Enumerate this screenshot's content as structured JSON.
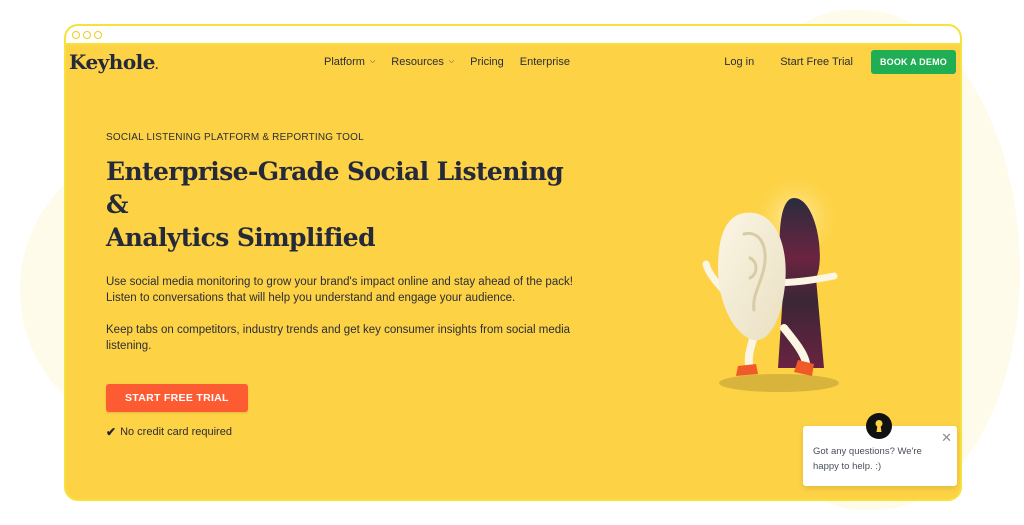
{
  "colors": {
    "page_yellow": "#fdd245",
    "frame_border": "#f7e13c",
    "dark_text": "#252a3b",
    "cta_orange": "#fd5b32",
    "demo_green": "#1fae53"
  },
  "header": {
    "logo": "Keyhole",
    "nav": [
      {
        "label": "Platform",
        "has_dropdown": true
      },
      {
        "label": "Resources",
        "has_dropdown": true
      },
      {
        "label": "Pricing",
        "has_dropdown": false
      },
      {
        "label": "Enterprise",
        "has_dropdown": false
      }
    ],
    "login": "Log in",
    "start_trial": "Start Free Trial",
    "book_demo": "BOOK A DEMO"
  },
  "hero": {
    "eyebrow": "SOCIAL LISTENING PLATFORM & REPORTING TOOL",
    "headline_line1": "Enterprise-Grade Social Listening &",
    "headline_line2": "Analytics Simplified",
    "paragraph1": "Use social media monitoring to grow your brand's impact online and stay ahead of the pack! Listen to conversations that will help you understand and engage your audience.",
    "paragraph2": "Keep tabs on competitors, industry trends and get key consumer insights from social media listening.",
    "cta": "START FREE TRIAL",
    "note": "No credit card required",
    "check_icon": "✔",
    "illustration": "ear-character-with-keyhole"
  },
  "chat": {
    "message": "Got any questions? We're happy to help. :)",
    "close_icon": "✕",
    "avatar_icon": "keyhole-icon"
  }
}
